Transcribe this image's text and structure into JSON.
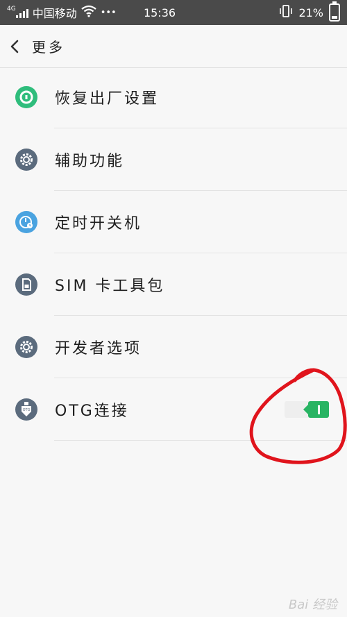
{
  "status_bar": {
    "network_type": "4G",
    "carrier": "中国移动",
    "more": "•••",
    "time": "15:36",
    "battery_percent": "21%",
    "battery_level": 0.21
  },
  "header": {
    "back_icon": "chevron-left-icon",
    "title": "更多"
  },
  "items": [
    {
      "label": "恢复出厂设置",
      "icon": "restore-icon",
      "icon_color": "#2fbd7c"
    },
    {
      "label": "辅助功能",
      "icon": "gear-icon",
      "icon_color": "#5b6b7d"
    },
    {
      "label": "定时开关机",
      "icon": "clock-power-icon",
      "icon_color": "#4aa3e0"
    },
    {
      "label": "SIM 卡工具包",
      "icon": "sim-card-icon",
      "icon_color": "#5b6b7d"
    },
    {
      "label": "开发者选项",
      "icon": "gear-icon",
      "icon_color": "#5b6b7d"
    },
    {
      "label": "OTG连接",
      "icon": "otg-icon",
      "icon_color": "#5b6b7d",
      "toggle_on": true
    }
  ],
  "watermark": "Bai 经验",
  "colors": {
    "status_bar": "#4a4a4a",
    "background": "#f7f7f7",
    "toggle_on": "#28b463",
    "annotation": "#e0141c"
  }
}
